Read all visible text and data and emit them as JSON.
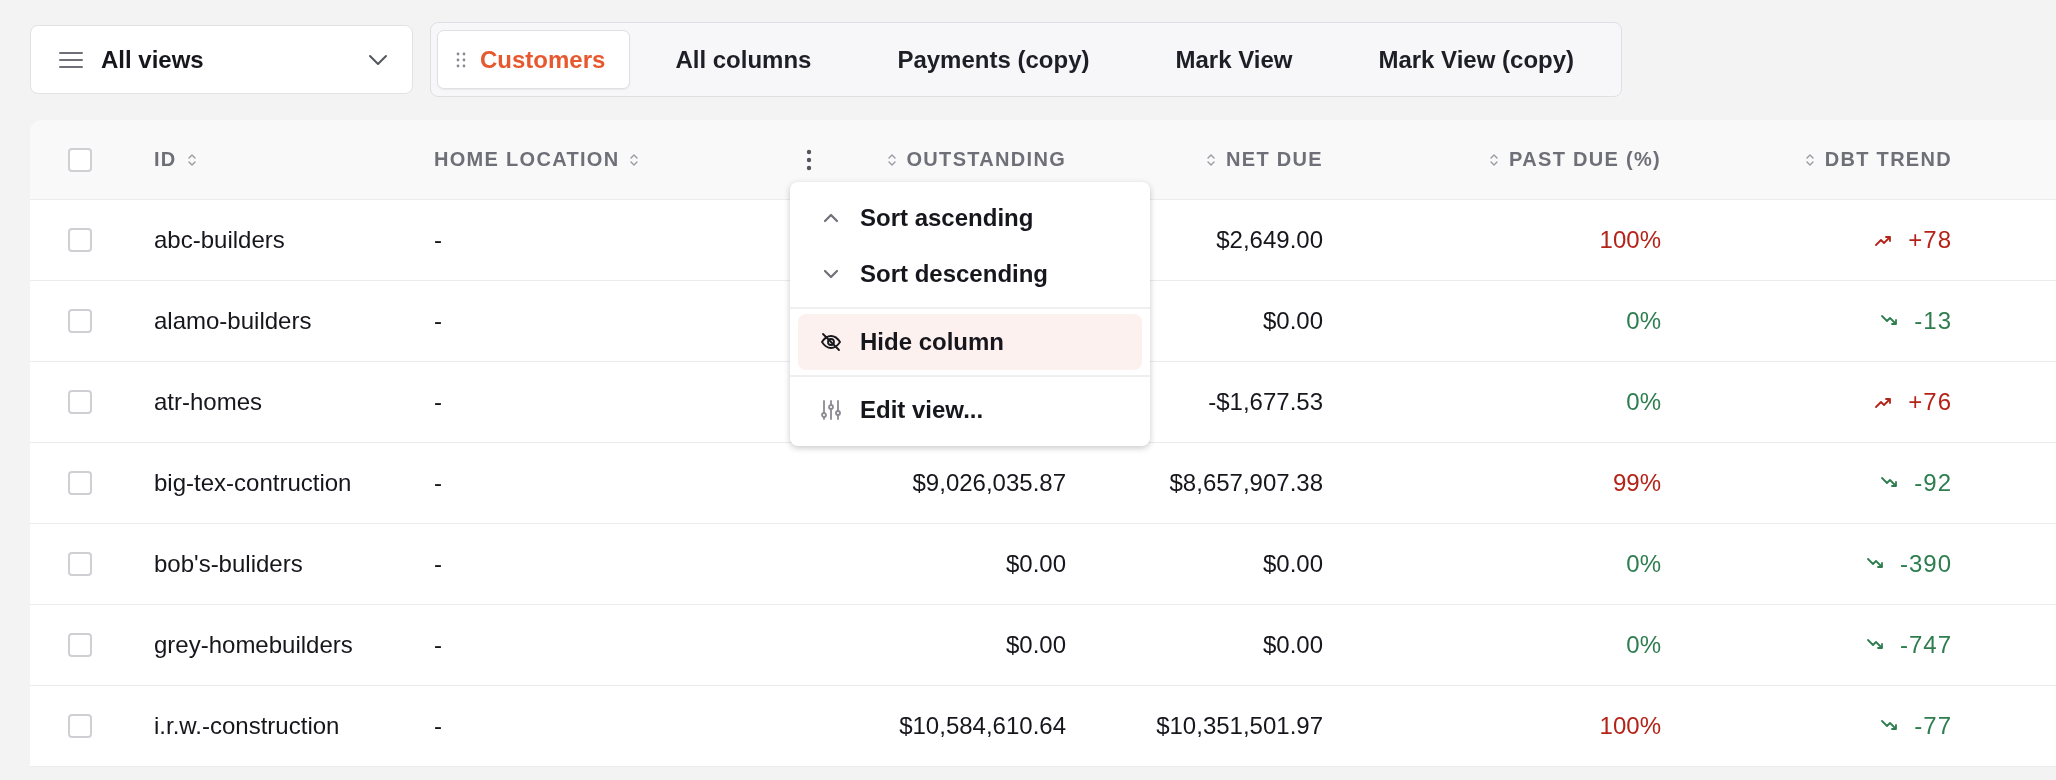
{
  "views_dropdown": {
    "label": "All views"
  },
  "tabs": [
    {
      "label": "Customers",
      "selected": true
    },
    {
      "label": "All columns",
      "selected": false
    },
    {
      "label": "Payments (copy)",
      "selected": false
    },
    {
      "label": "Mark View",
      "selected": false
    },
    {
      "label": "Mark View (copy)",
      "selected": false
    }
  ],
  "table": {
    "select_all_checked": false,
    "columns": [
      {
        "label": "ID",
        "kind": "text",
        "menu_open": false
      },
      {
        "label": "HOME LOCATION",
        "kind": "text",
        "menu_open": false
      },
      {
        "label": "OUTSTANDING",
        "kind": "number",
        "menu_open": true
      },
      {
        "label": "NET DUE",
        "kind": "number",
        "menu_open": false
      },
      {
        "label": "PAST DUE (%)",
        "kind": "number",
        "menu_open": false
      },
      {
        "label": "DBT TREND",
        "kind": "number",
        "menu_open": false
      }
    ],
    "rows": [
      {
        "checked": false,
        "id": "abc-builders",
        "home_location": "-",
        "net_due": "$2,649.00",
        "past_due": {
          "value": "100%",
          "color": "#b42318"
        },
        "dbt_trend": {
          "kind": "up",
          "value": "+78",
          "color": "#b42318"
        }
      },
      {
        "checked": false,
        "id": "alamo-builders",
        "home_location": "-",
        "net_due": "$0.00",
        "past_due": {
          "value": "0%",
          "color": "#2e7d4f"
        },
        "dbt_trend": {
          "kind": "down",
          "value": "-13",
          "color": "#2e7d4f"
        }
      },
      {
        "checked": false,
        "id": "atr-homes",
        "home_location": "-",
        "net_due": "-$1,677.53",
        "past_due": {
          "value": "0%",
          "color": "#2e7d4f"
        },
        "dbt_trend": {
          "kind": "up",
          "value": "+76",
          "color": "#b42318"
        }
      },
      {
        "checked": false,
        "id": "big-tex-contruction",
        "home_location": "-",
        "outstanding": "$9,026,035.87",
        "net_due": "$8,657,907.38",
        "past_due": {
          "value": "99%",
          "color": "#b42318"
        },
        "dbt_trend": {
          "kind": "down",
          "value": "-92",
          "color": "#2e7d4f"
        }
      },
      {
        "checked": false,
        "id": "bob's-buliders",
        "home_location": "-",
        "outstanding": "$0.00",
        "net_due": "$0.00",
        "past_due": {
          "value": "0%",
          "color": "#2e7d4f"
        },
        "dbt_trend": {
          "kind": "down",
          "value": "-390",
          "color": "#2e7d4f"
        }
      },
      {
        "checked": false,
        "id": "grey-homebuilders",
        "home_location": "-",
        "outstanding": "$0.00",
        "net_due": "$0.00",
        "past_due": {
          "value": "0%",
          "color": "#2e7d4f"
        },
        "dbt_trend": {
          "kind": "down",
          "value": "-747",
          "color": "#2e7d4f"
        }
      },
      {
        "checked": false,
        "id": "i.r.w.-construction",
        "home_location": "-",
        "outstanding": "$10,584,610.64",
        "net_due": "$10,351,501.97",
        "past_due": {
          "value": "100%",
          "color": "#b42318"
        },
        "dbt_trend": {
          "kind": "down",
          "value": "-77",
          "color": "#2e7d4f"
        }
      }
    ]
  },
  "column_menu": {
    "groups": [
      {
        "items": [
          {
            "kind": "sort-asc",
            "label": "Sort ascending",
            "highlighted": false
          },
          {
            "kind": "sort-desc",
            "label": "Sort descending",
            "highlighted": false
          }
        ]
      },
      {
        "items": [
          {
            "kind": "hide",
            "label": "Hide column",
            "highlighted": true
          }
        ]
      },
      {
        "items": [
          {
            "kind": "edit",
            "label": "Edit view...",
            "highlighted": false
          }
        ]
      }
    ]
  }
}
